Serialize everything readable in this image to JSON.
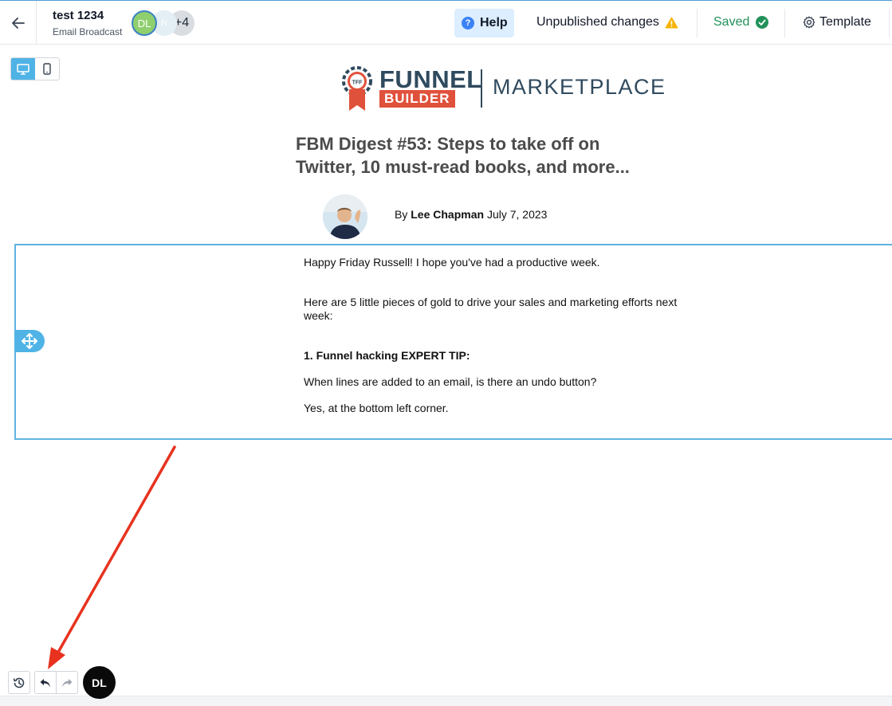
{
  "header": {
    "back_icon": "arrow-left-icon",
    "title": "test 1234",
    "subtitle": "Email Broadcast",
    "collaborators": {
      "first_initials": "DL",
      "second_initials": "N",
      "more_count": "+4"
    },
    "help_label": "Help",
    "unpublished_label": "Unpublished changes",
    "saved_label": "Saved",
    "template_label": "Template"
  },
  "device_toggle": {
    "desktop_icon": "desktop-icon",
    "mobile_icon": "mobile-icon",
    "active": "desktop"
  },
  "email": {
    "logo": {
      "funnel": "FUNNEL",
      "builder": "BUILDER",
      "marketplace": "MARKETPLACE",
      "badge_text": "TFF"
    },
    "headline_line1": "FBM Digest #53: Steps to take off on",
    "headline_line2": "Twitter, 10 must-read books, and more...",
    "byline_prefix": "By",
    "author": "Lee Chapman",
    "date": "July 7, 2023",
    "paragraphs": {
      "p1": "Happy Friday Russell! I hope you've had a productive week.",
      "p2": "Here are 5 little pieces of gold to drive your sales and marketing efforts next week:",
      "p3": "1. Funnel hacking EXPERT TIP:",
      "p4": "When lines are added to an email, is there an undo button?",
      "p5": "Yes, at the bottom left corner."
    }
  },
  "toolbar": {
    "history_icon": "history-icon",
    "undo_icon": "undo-icon",
    "redo_icon": "redo-icon",
    "user_initials": "DL"
  },
  "colors": {
    "accent": "#4fb3e6",
    "saved_green": "#22915a",
    "warning": "#f5b301",
    "annotation_arrow": "#e8321e"
  }
}
